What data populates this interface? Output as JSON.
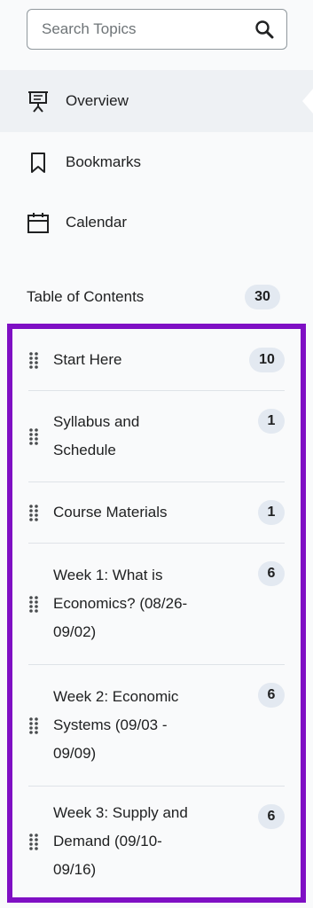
{
  "search": {
    "placeholder": "Search Topics",
    "value": "",
    "icon": "search-icon"
  },
  "nav": [
    {
      "label": "Overview",
      "icon": "presentation-icon",
      "active": true
    },
    {
      "label": "Bookmarks",
      "icon": "bookmark-icon",
      "active": false
    },
    {
      "label": "Calendar",
      "icon": "calendar-icon",
      "active": false
    }
  ],
  "toc": {
    "label": "Table of Contents",
    "count": "30"
  },
  "units": [
    {
      "title": "Start Here",
      "count": "10"
    },
    {
      "title": "Syllabus and Schedule",
      "count": "1"
    },
    {
      "title": "Course Materials",
      "count": "1"
    },
    {
      "title": "Week 1: What is Economics? (08/26-09/02)",
      "count": "6"
    },
    {
      "title": "Week 2: Economic Systems (09/03 - 09/09)",
      "count": "6"
    },
    {
      "title": "Week 3: Supply and Demand (09/10-09/16)",
      "count": "6"
    }
  ],
  "colors": {
    "highlight_border": "#7f0fc4",
    "active_bg": "#eef1f4",
    "badge_bg": "#e3e9f1"
  }
}
